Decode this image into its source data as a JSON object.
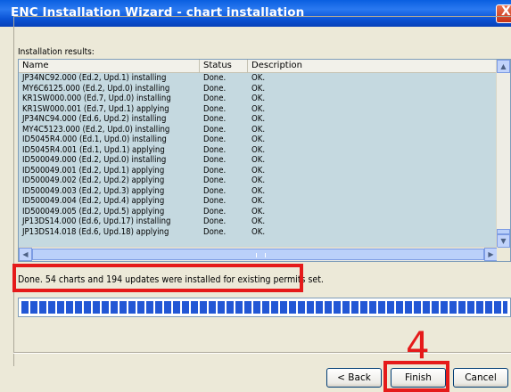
{
  "window": {
    "title": "ENC Installation Wizard - chart installation",
    "close_glyph": "X"
  },
  "results": {
    "label": "Installation results:",
    "columns": [
      "Name",
      "Status",
      "Description"
    ],
    "rows": [
      {
        "name": "JP34NC92.000 (Ed.2, Upd.1) installing",
        "status": "Done.",
        "desc": "OK."
      },
      {
        "name": "MY6C6125.000 (Ed.2, Upd.0) installing",
        "status": "Done.",
        "desc": "OK."
      },
      {
        "name": "KR1SW000.000 (Ed.7, Upd.0) installing",
        "status": "Done.",
        "desc": "OK."
      },
      {
        "name": "KR1SW000.001 (Ed.7, Upd.1) applying",
        "status": "Done.",
        "desc": "OK."
      },
      {
        "name": "JP34NC94.000 (Ed.6, Upd.2) installing",
        "status": "Done.",
        "desc": "OK."
      },
      {
        "name": "MY4C5123.000 (Ed.2, Upd.0) installing",
        "status": "Done.",
        "desc": "OK."
      },
      {
        "name": "ID5045R4.000 (Ed.1, Upd.0) installing",
        "status": "Done.",
        "desc": "OK."
      },
      {
        "name": "ID5045R4.001 (Ed.1, Upd.1) applying",
        "status": "Done.",
        "desc": "OK."
      },
      {
        "name": "ID500049.000 (Ed.2, Upd.0) installing",
        "status": "Done.",
        "desc": "OK."
      },
      {
        "name": "ID500049.001 (Ed.2, Upd.1) applying",
        "status": "Done.",
        "desc": "OK."
      },
      {
        "name": "ID500049.002 (Ed.2, Upd.2) applying",
        "status": "Done.",
        "desc": "OK."
      },
      {
        "name": "ID500049.003 (Ed.2, Upd.3) applying",
        "status": "Done.",
        "desc": "OK."
      },
      {
        "name": "ID500049.004 (Ed.2, Upd.4) applying",
        "status": "Done.",
        "desc": "OK."
      },
      {
        "name": "ID500049.005 (Ed.2, Upd.5) applying",
        "status": "Done.",
        "desc": "OK."
      },
      {
        "name": "JP13DS14.000 (Ed.6, Upd.17) installing",
        "status": "Done.",
        "desc": "OK."
      },
      {
        "name": "JP13DS14.018 (Ed.6, Upd.18) applying",
        "status": "Done.",
        "desc": "OK."
      }
    ]
  },
  "status_message": "Done.  54 charts and 194 updates were installed for existing permits set.",
  "progress": {
    "fraction": 1.0
  },
  "annotation": {
    "step_number": "4",
    "color": "#E51A1A"
  },
  "buttons": {
    "back": "< Back",
    "finish": "Finish",
    "cancel": "Cancel"
  },
  "icons": {
    "scroll_up": "▲",
    "scroll_down": "▼",
    "scroll_left": "◀",
    "scroll_right": "▶"
  }
}
